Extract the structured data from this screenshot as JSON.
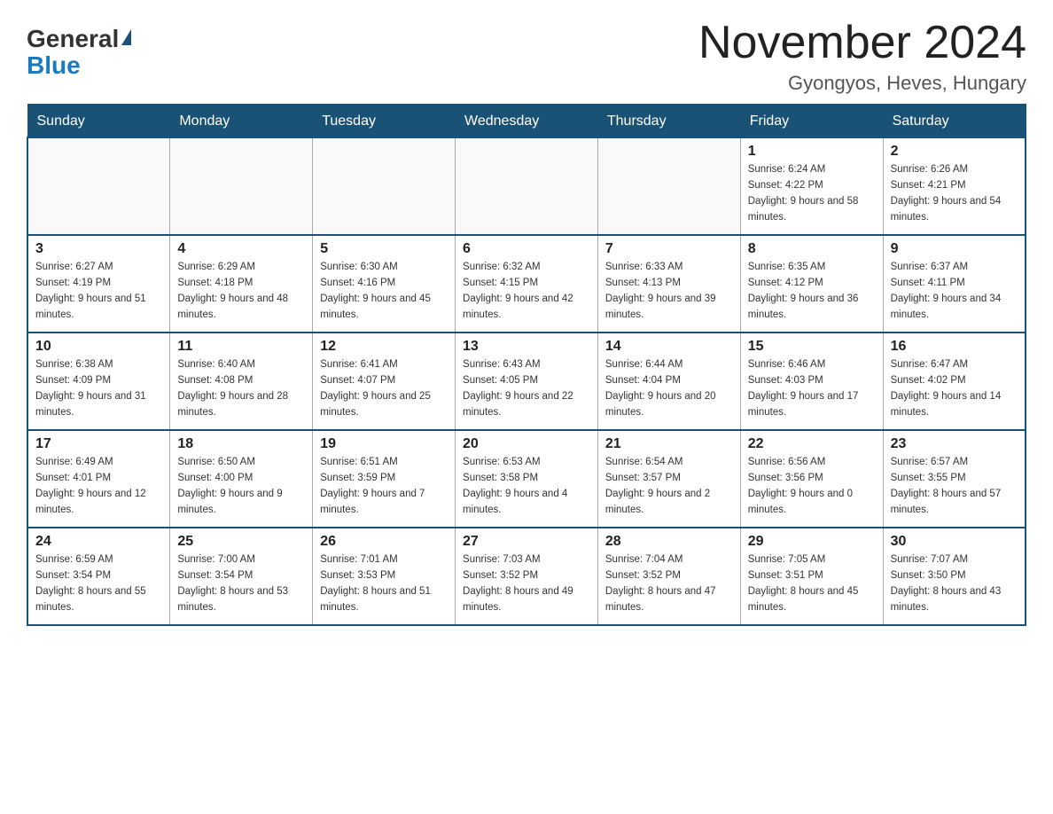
{
  "header": {
    "logo": {
      "general": "General",
      "blue": "Blue",
      "triangle": "▶"
    },
    "title": "November 2024",
    "subtitle": "Gyongyos, Heves, Hungary"
  },
  "days_of_week": [
    "Sunday",
    "Monday",
    "Tuesday",
    "Wednesday",
    "Thursday",
    "Friday",
    "Saturday"
  ],
  "weeks": [
    [
      {
        "day": "",
        "info": ""
      },
      {
        "day": "",
        "info": ""
      },
      {
        "day": "",
        "info": ""
      },
      {
        "day": "",
        "info": ""
      },
      {
        "day": "",
        "info": ""
      },
      {
        "day": "1",
        "info": "Sunrise: 6:24 AM\nSunset: 4:22 PM\nDaylight: 9 hours and 58 minutes."
      },
      {
        "day": "2",
        "info": "Sunrise: 6:26 AM\nSunset: 4:21 PM\nDaylight: 9 hours and 54 minutes."
      }
    ],
    [
      {
        "day": "3",
        "info": "Sunrise: 6:27 AM\nSunset: 4:19 PM\nDaylight: 9 hours and 51 minutes."
      },
      {
        "day": "4",
        "info": "Sunrise: 6:29 AM\nSunset: 4:18 PM\nDaylight: 9 hours and 48 minutes."
      },
      {
        "day": "5",
        "info": "Sunrise: 6:30 AM\nSunset: 4:16 PM\nDaylight: 9 hours and 45 minutes."
      },
      {
        "day": "6",
        "info": "Sunrise: 6:32 AM\nSunset: 4:15 PM\nDaylight: 9 hours and 42 minutes."
      },
      {
        "day": "7",
        "info": "Sunrise: 6:33 AM\nSunset: 4:13 PM\nDaylight: 9 hours and 39 minutes."
      },
      {
        "day": "8",
        "info": "Sunrise: 6:35 AM\nSunset: 4:12 PM\nDaylight: 9 hours and 36 minutes."
      },
      {
        "day": "9",
        "info": "Sunrise: 6:37 AM\nSunset: 4:11 PM\nDaylight: 9 hours and 34 minutes."
      }
    ],
    [
      {
        "day": "10",
        "info": "Sunrise: 6:38 AM\nSunset: 4:09 PM\nDaylight: 9 hours and 31 minutes."
      },
      {
        "day": "11",
        "info": "Sunrise: 6:40 AM\nSunset: 4:08 PM\nDaylight: 9 hours and 28 minutes."
      },
      {
        "day": "12",
        "info": "Sunrise: 6:41 AM\nSunset: 4:07 PM\nDaylight: 9 hours and 25 minutes."
      },
      {
        "day": "13",
        "info": "Sunrise: 6:43 AM\nSunset: 4:05 PM\nDaylight: 9 hours and 22 minutes."
      },
      {
        "day": "14",
        "info": "Sunrise: 6:44 AM\nSunset: 4:04 PM\nDaylight: 9 hours and 20 minutes."
      },
      {
        "day": "15",
        "info": "Sunrise: 6:46 AM\nSunset: 4:03 PM\nDaylight: 9 hours and 17 minutes."
      },
      {
        "day": "16",
        "info": "Sunrise: 6:47 AM\nSunset: 4:02 PM\nDaylight: 9 hours and 14 minutes."
      }
    ],
    [
      {
        "day": "17",
        "info": "Sunrise: 6:49 AM\nSunset: 4:01 PM\nDaylight: 9 hours and 12 minutes."
      },
      {
        "day": "18",
        "info": "Sunrise: 6:50 AM\nSunset: 4:00 PM\nDaylight: 9 hours and 9 minutes."
      },
      {
        "day": "19",
        "info": "Sunrise: 6:51 AM\nSunset: 3:59 PM\nDaylight: 9 hours and 7 minutes."
      },
      {
        "day": "20",
        "info": "Sunrise: 6:53 AM\nSunset: 3:58 PM\nDaylight: 9 hours and 4 minutes."
      },
      {
        "day": "21",
        "info": "Sunrise: 6:54 AM\nSunset: 3:57 PM\nDaylight: 9 hours and 2 minutes."
      },
      {
        "day": "22",
        "info": "Sunrise: 6:56 AM\nSunset: 3:56 PM\nDaylight: 9 hours and 0 minutes."
      },
      {
        "day": "23",
        "info": "Sunrise: 6:57 AM\nSunset: 3:55 PM\nDaylight: 8 hours and 57 minutes."
      }
    ],
    [
      {
        "day": "24",
        "info": "Sunrise: 6:59 AM\nSunset: 3:54 PM\nDaylight: 8 hours and 55 minutes."
      },
      {
        "day": "25",
        "info": "Sunrise: 7:00 AM\nSunset: 3:54 PM\nDaylight: 8 hours and 53 minutes."
      },
      {
        "day": "26",
        "info": "Sunrise: 7:01 AM\nSunset: 3:53 PM\nDaylight: 8 hours and 51 minutes."
      },
      {
        "day": "27",
        "info": "Sunrise: 7:03 AM\nSunset: 3:52 PM\nDaylight: 8 hours and 49 minutes."
      },
      {
        "day": "28",
        "info": "Sunrise: 7:04 AM\nSunset: 3:52 PM\nDaylight: 8 hours and 47 minutes."
      },
      {
        "day": "29",
        "info": "Sunrise: 7:05 AM\nSunset: 3:51 PM\nDaylight: 8 hours and 45 minutes."
      },
      {
        "day": "30",
        "info": "Sunrise: 7:07 AM\nSunset: 3:50 PM\nDaylight: 8 hours and 43 minutes."
      }
    ]
  ]
}
